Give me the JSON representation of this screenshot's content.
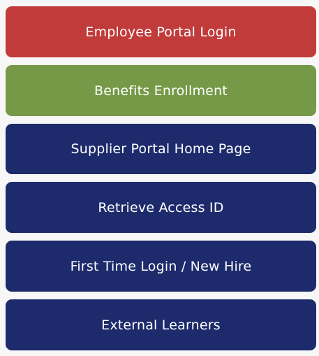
{
  "menu": {
    "buttons": [
      {
        "label": "Employee Portal Login",
        "color": "#c13b3a"
      },
      {
        "label": "Benefits Enrollment",
        "color": "#759946"
      },
      {
        "label": "Supplier Portal Home Page",
        "color": "#1d2b6c"
      },
      {
        "label": "Retrieve Access ID",
        "color": "#1d2b6c"
      },
      {
        "label": "First Time Login / New Hire",
        "color": "#1d2b6c"
      },
      {
        "label": "External Learners",
        "color": "#1d2b6c"
      }
    ]
  }
}
